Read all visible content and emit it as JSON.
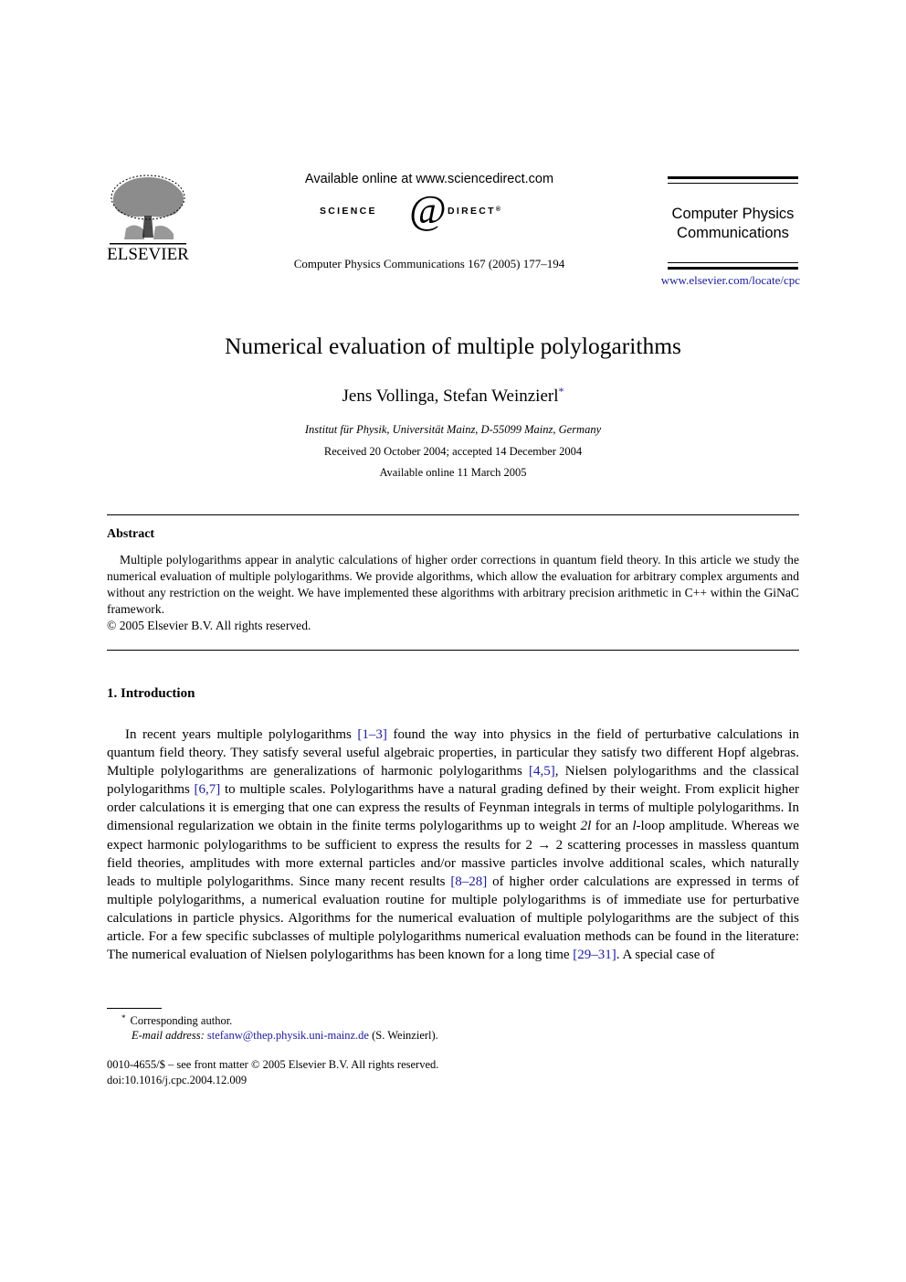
{
  "header": {
    "publisher_wordmark": "ELSEVIER",
    "available_online": "Available online at www.sciencedirect.com",
    "sciencedirect_left": "SCIENCE",
    "sciencedirect_symbol": "d",
    "sciencedirect_right": "DIRECT",
    "sciencedirect_mark": "®",
    "journal_reference": "Computer Physics Communications 167 (2005) 177–194",
    "journal_name_line1": "Computer Physics",
    "journal_name_line2": "Communications",
    "journal_url": "www.elsevier.com/locate/cpc"
  },
  "article": {
    "title": "Numerical evaluation of multiple polylogarithms",
    "authors": "Jens Vollinga, Stefan Weinzierl",
    "author_mark": "*",
    "affiliation": "Institut für Physik, Universität Mainz, D-55099 Mainz, Germany",
    "received": "Received 20 October 2004; accepted 14 December 2004",
    "available": "Available online 11 March 2005"
  },
  "abstract": {
    "heading": "Abstract",
    "text": "Multiple polylogarithms appear in analytic calculations of higher order corrections in quantum field theory. In this article we study the numerical evaluation of multiple polylogarithms. We provide algorithms, which allow the evaluation for arbitrary complex arguments and without any restriction on the weight. We have implemented these algorithms with arbitrary precision arithmetic in C++ within the GiNaC framework.",
    "copyright": "© 2005 Elsevier B.V. All rights reserved."
  },
  "introduction": {
    "heading": "1.  Introduction",
    "segments": [
      {
        "t": "In recent years multiple polylogarithms "
      },
      {
        "t": "[1–3]",
        "ref": true
      },
      {
        "t": " found the way into physics in the field of perturbative calculations in quantum field theory. They satisfy several useful algebraic properties, in particular they satisfy two different Hopf algebras. Multiple polylogarithms are generalizations of harmonic polylogarithms "
      },
      {
        "t": "[4,5]",
        "ref": true
      },
      {
        "t": ", Nielsen polyloga­rithms and the classical polylogarithms "
      },
      {
        "t": "[6,7]",
        "ref": true
      },
      {
        "t": " to multiple scales. Polylogarithms have a natural grading defined by their weight. From explicit higher order calculations it is emerging that one can express the results of Feynman integrals in terms of multiple polylogarithms. In dimensional regularization we obtain in the finite terms polylog­arithms up to weight "
      },
      {
        "t": "2l",
        "italic": true
      },
      {
        "t": " for an "
      },
      {
        "t": "l",
        "italic": true
      },
      {
        "t": "-loop amplitude. Whereas we expect harmonic polylogarithms to be sufficient to express the results for 2 → 2 scattering processes in massless quantum field theories, amplitudes with more exter­nal particles and/or massive particles involve additional scales, which naturally leads to multiple polylogarithms. Since many recent results "
      },
      {
        "t": "[8–28]",
        "ref": true
      },
      {
        "t": " of higher order calculations are expressed in terms of multiple polylogarithms, a numerical evaluation routine for multiple polylogarithms is of immediate use for perturbative calculations in parti­cle physics. Algorithms for the numerical evaluation of multiple polylogarithms are the subject of this article. For a few specific subclasses of multiple polylogarithms numerical evaluation methods can be found in the literature: The numerical evaluation of Nielsen polylogarithms has been known for a long time "
      },
      {
        "t": "[29–31]",
        "ref": true
      },
      {
        "t": ". A special case of"
      }
    ]
  },
  "footnotes": {
    "author_mark": "*",
    "corresponding": "Corresponding author.",
    "email_label": "E-mail address:",
    "email": "stefanw@thep.physik.uni-mainz.de",
    "email_owner": " (S. Weinzierl).",
    "front_matter": "0010-4655/$ – see front matter  © 2005 Elsevier B.V. All rights reserved.",
    "doi": "doi:10.1016/j.cpc.2004.12.009"
  },
  "colors": {
    "link": "#1a1a9c",
    "text": "#000000"
  }
}
